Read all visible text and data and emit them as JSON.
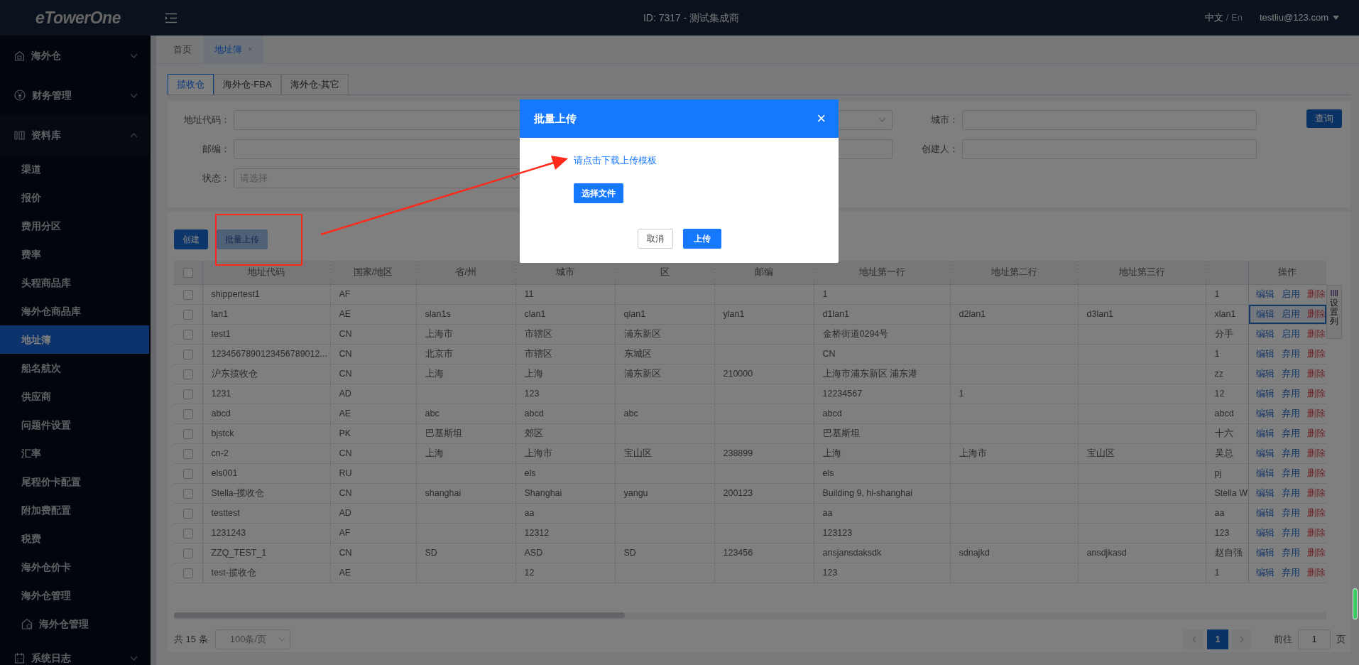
{
  "header": {
    "logo": "eTowerOne",
    "title": "ID: 7317 - 测试集成商",
    "languages": [
      {
        "label": "中文",
        "selected": true
      },
      {
        "label": "En",
        "selected": false
      }
    ],
    "separator": "/",
    "user": "testliu@123.com"
  },
  "sidebar": {
    "items": [
      {
        "label": "海外仓",
        "expanded": false
      },
      {
        "label": "财务管理",
        "expanded": false
      },
      {
        "label": "资料库",
        "expanded": true,
        "children": [
          {
            "label": "渠道",
            "selected": false,
            "kind": "plain"
          },
          {
            "label": "报价",
            "selected": false,
            "kind": "plain"
          },
          {
            "label": "费用分区",
            "selected": false,
            "kind": "plain"
          },
          {
            "label": "费率",
            "selected": false,
            "kind": "plain"
          },
          {
            "label": "头程商品库",
            "selected": false,
            "kind": "plain"
          },
          {
            "label": "海外仓商品库",
            "selected": false,
            "kind": "plain"
          },
          {
            "label": "地址簿",
            "selected": true,
            "kind": "plain"
          },
          {
            "label": "船名航次",
            "selected": false,
            "kind": "plain"
          },
          {
            "label": "供应商",
            "selected": false,
            "kind": "plain"
          },
          {
            "label": "问题件设置",
            "selected": false,
            "kind": "plain"
          },
          {
            "label": "汇率",
            "selected": false,
            "kind": "plain"
          },
          {
            "label": "尾程价卡配置",
            "selected": false,
            "kind": "plain"
          },
          {
            "label": "附加费配置",
            "selected": false,
            "kind": "plain"
          },
          {
            "label": "税费",
            "selected": false,
            "kind": "plain"
          },
          {
            "label": "海外仓价卡",
            "selected": false,
            "kind": "plain"
          },
          {
            "label": "海外仓管理",
            "selected": false,
            "kind": "plain"
          },
          {
            "label": "海外仓管理",
            "selected": false,
            "kind": "icon"
          }
        ]
      },
      {
        "label": "系统日志",
        "expanded": false
      }
    ]
  },
  "page_tabs": [
    {
      "label": "首页",
      "selected": false
    },
    {
      "label": "地址簿",
      "selected": true,
      "close": "×"
    }
  ],
  "sub_tabs": [
    {
      "label": "揽收仓",
      "selected": true
    },
    {
      "label": "海外仓-FBA",
      "selected": false
    },
    {
      "label": "海外仓-其它",
      "selected": false
    }
  ],
  "filters": [
    {
      "label": "地址代码：",
      "kind": "input"
    },
    {
      "kind": "select"
    },
    {
      "label": "城市：",
      "kind": "input"
    },
    {
      "label": "邮编：",
      "kind": "input"
    },
    {
      "kind": "input"
    },
    {
      "label": "创建人：",
      "kind": "input"
    },
    {
      "label": "状态：",
      "kind": "select",
      "placeholder": "请选择"
    }
  ],
  "search_button": "查询",
  "toolbar": [
    {
      "label": "创建",
      "kind": "primary"
    },
    {
      "label": "批量上传",
      "kind": "light"
    }
  ],
  "table": {
    "header_checked": false,
    "columns": [
      "地址代码",
      "国家/地区",
      "省/州",
      "城市",
      "区",
      "邮编",
      "地址第一行",
      "地址第二行",
      "地址第三行",
      "操作"
    ],
    "settings_tab": "设置列",
    "rows": [
      {
        "checked": false,
        "focused": false,
        "cells": [
          "shippertest1",
          "AF",
          "",
          "11",
          "",
          "",
          "1",
          "",
          "",
          "1"
        ],
        "actions": [
          {
            "label": "编辑",
            "kind": "edit"
          },
          {
            "label": "启用",
            "kind": "toggle"
          },
          {
            "label": "删除",
            "kind": "delete"
          }
        ]
      },
      {
        "checked": false,
        "focused": true,
        "cells": [
          "lan1",
          "AE",
          "slan1s",
          "clan1",
          "qlan1",
          "ylan1",
          "d1lan1",
          "d2lan1",
          "d3lan1",
          "xlan1"
        ],
        "actions": [
          {
            "label": "编辑",
            "kind": "edit"
          },
          {
            "label": "启用",
            "kind": "toggle"
          },
          {
            "label": "删除",
            "kind": "delete"
          }
        ]
      },
      {
        "checked": false,
        "focused": false,
        "cells": [
          "test1",
          "CN",
          "上海市",
          "市辖区",
          "浦东新区",
          "",
          "金桥街道0294号",
          "",
          "",
          "分手"
        ],
        "actions": [
          {
            "label": "编辑",
            "kind": "edit"
          },
          {
            "label": "启用",
            "kind": "toggle"
          },
          {
            "label": "删除",
            "kind": "delete"
          }
        ]
      },
      {
        "checked": false,
        "focused": false,
        "cells": [
          "1234567890123456789012...",
          "CN",
          "北京市",
          "市辖区",
          "东城区",
          "",
          "CN",
          "",
          "",
          "1"
        ],
        "actions": [
          {
            "label": "编辑",
            "kind": "edit"
          },
          {
            "label": "弃用",
            "kind": "toggle"
          },
          {
            "label": "删除",
            "kind": "delete"
          }
        ]
      },
      {
        "checked": false,
        "focused": false,
        "cells": [
          "沪东揽收仓",
          "CN",
          "上海",
          "上海",
          "浦东新区",
          "210000",
          "上海市浦东新区 浦东港",
          "",
          "",
          "zz"
        ],
        "actions": [
          {
            "label": "编辑",
            "kind": "edit"
          },
          {
            "label": "弃用",
            "kind": "toggle"
          },
          {
            "label": "删除",
            "kind": "delete"
          }
        ]
      },
      {
        "checked": false,
        "focused": false,
        "cells": [
          "1231",
          "AD",
          "",
          "123",
          "",
          "",
          "12234567",
          "1",
          "",
          "12"
        ],
        "actions": [
          {
            "label": "编辑",
            "kind": "edit"
          },
          {
            "label": "弃用",
            "kind": "toggle"
          },
          {
            "label": "删除",
            "kind": "delete"
          }
        ]
      },
      {
        "checked": false,
        "focused": false,
        "cells": [
          "abcd",
          "AE",
          "abc",
          "abcd",
          "abc",
          "",
          "abcd",
          "",
          "",
          "abcd"
        ],
        "actions": [
          {
            "label": "编辑",
            "kind": "edit"
          },
          {
            "label": "弃用",
            "kind": "toggle"
          },
          {
            "label": "删除",
            "kind": "delete"
          }
        ]
      },
      {
        "checked": false,
        "focused": false,
        "cells": [
          "bjstck",
          "PK",
          "巴基斯坦",
          "郊区",
          "",
          "",
          "巴基斯坦",
          "",
          "",
          "十六"
        ],
        "actions": [
          {
            "label": "编辑",
            "kind": "edit"
          },
          {
            "label": "弃用",
            "kind": "toggle"
          },
          {
            "label": "删除",
            "kind": "delete"
          }
        ]
      },
      {
        "checked": false,
        "focused": false,
        "cells": [
          "cn-2",
          "CN",
          "上海",
          "上海市",
          "宝山区",
          "238899",
          "上海",
          "上海市",
          "宝山区",
          "吴总"
        ],
        "actions": [
          {
            "label": "编辑",
            "kind": "edit"
          },
          {
            "label": "弃用",
            "kind": "toggle"
          },
          {
            "label": "删除",
            "kind": "delete"
          }
        ]
      },
      {
        "checked": false,
        "focused": false,
        "cells": [
          "els001",
          "RU",
          "",
          "els",
          "",
          "",
          "els",
          "",
          "",
          "pj"
        ],
        "actions": [
          {
            "label": "编辑",
            "kind": "edit"
          },
          {
            "label": "弃用",
            "kind": "toggle"
          },
          {
            "label": "删除",
            "kind": "delete"
          }
        ]
      },
      {
        "checked": false,
        "focused": false,
        "cells": [
          "Stella-揽收仓",
          "CN",
          "shanghai",
          "Shanghai",
          "yangu",
          "200123",
          "Building 9, hi-shanghai",
          "",
          "",
          "Stella W"
        ],
        "actions": [
          {
            "label": "编辑",
            "kind": "edit"
          },
          {
            "label": "弃用",
            "kind": "toggle"
          },
          {
            "label": "删除",
            "kind": "delete"
          }
        ]
      },
      {
        "checked": false,
        "focused": false,
        "cells": [
          "testtest",
          "AD",
          "",
          "aa",
          "",
          "",
          "aa",
          "",
          "",
          "aa"
        ],
        "actions": [
          {
            "label": "编辑",
            "kind": "edit"
          },
          {
            "label": "弃用",
            "kind": "toggle"
          },
          {
            "label": "删除",
            "kind": "delete"
          }
        ]
      },
      {
        "checked": false,
        "focused": false,
        "cells": [
          "1231243",
          "AF",
          "",
          "12312",
          "",
          "",
          "123123",
          "",
          "",
          "123"
        ],
        "actions": [
          {
            "label": "编辑",
            "kind": "edit"
          },
          {
            "label": "弃用",
            "kind": "toggle"
          },
          {
            "label": "删除",
            "kind": "delete"
          }
        ]
      },
      {
        "checked": false,
        "focused": false,
        "cells": [
          "ZZQ_TEST_1",
          "CN",
          "SD",
          "ASD",
          "SD",
          "123456",
          "ansjansdaksdk",
          "sdnajkd",
          "ansdjkasd",
          "赵自强"
        ],
        "actions": [
          {
            "label": "编辑",
            "kind": "edit"
          },
          {
            "label": "弃用",
            "kind": "toggle"
          },
          {
            "label": "删除",
            "kind": "delete"
          }
        ]
      },
      {
        "checked": false,
        "focused": false,
        "cells": [
          "test-揽收仓",
          "AE",
          "",
          "12",
          "",
          "",
          "123",
          "",
          "",
          "1"
        ],
        "actions": [
          {
            "label": "编辑",
            "kind": "edit"
          },
          {
            "label": "弃用",
            "kind": "toggle"
          },
          {
            "label": "删除",
            "kind": "delete"
          }
        ]
      }
    ]
  },
  "pagination": {
    "total": "共 15 条",
    "page_size": "100条/页",
    "pages": [
      {
        "label": "1",
        "selected": true
      }
    ],
    "goto_label": "前往",
    "goto_value": "1",
    "page_suffix": "页"
  },
  "modal": {
    "title": "批量上传",
    "close": "×",
    "link": "请点击下载上传模板",
    "file_button": "选择文件",
    "buttons": [
      {
        "label": "取消",
        "kind": "default"
      },
      {
        "label": "上传",
        "kind": "primary"
      }
    ]
  }
}
